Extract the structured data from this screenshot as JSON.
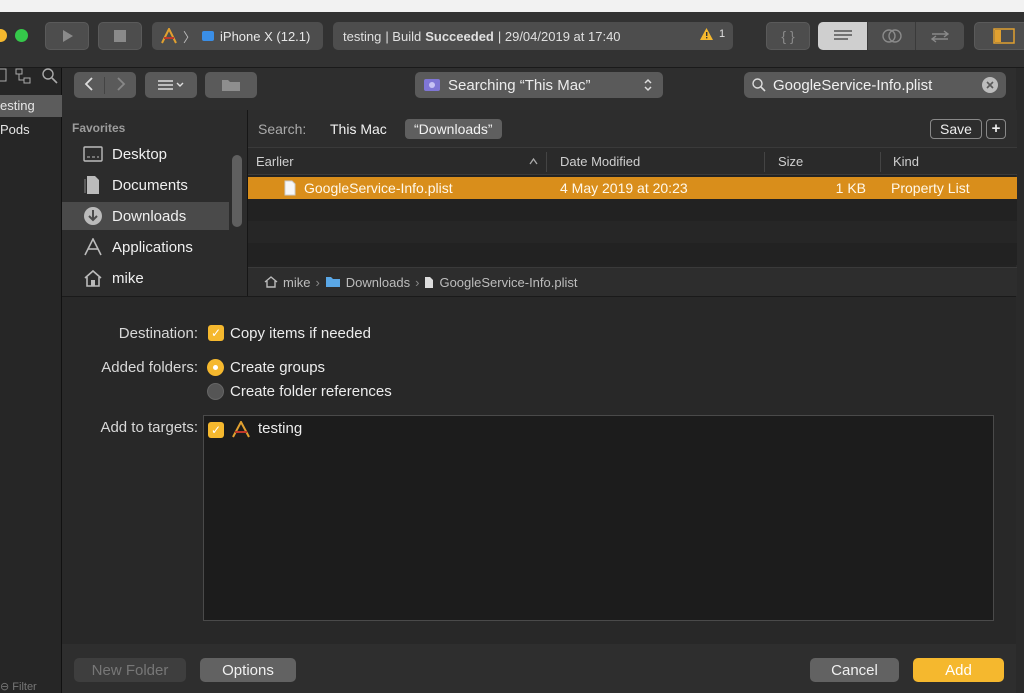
{
  "toolbar": {
    "device": "iPhone X (12.1)",
    "activity_project": "testing",
    "activity_sep": "| Build",
    "activity_status": "Succeeded",
    "activity_time": "| 29/04/2019 at 17:40",
    "warning_count": "1"
  },
  "navigator": {
    "items": [
      "esting",
      "Pods"
    ],
    "filter_placeholder": "Filter"
  },
  "sheet": {
    "location": "Searching “This Mac”",
    "search_value": "GoogleService-Info.plist",
    "sidebar": {
      "heading": "Favorites",
      "items": [
        {
          "label": "Desktop",
          "icon": "desktop-icon"
        },
        {
          "label": "Documents",
          "icon": "documents-icon"
        },
        {
          "label": "Downloads",
          "icon": "downloads-icon"
        },
        {
          "label": "Applications",
          "icon": "applications-icon"
        },
        {
          "label": "mike",
          "icon": "home-icon"
        }
      ]
    },
    "scope": {
      "label": "Search:",
      "this_mac": "This Mac",
      "downloads": "“Downloads”",
      "save": "Save",
      "add": "+"
    },
    "columns": {
      "name": "Earlier",
      "date": "Date Modified",
      "size": "Size",
      "kind": "Kind"
    },
    "rows": [
      {
        "name": "GoogleService-Info.plist",
        "date": "4 May 2019 at 20:23",
        "size": "1 KB",
        "kind": "Property List"
      }
    ],
    "path": [
      "mike",
      "Downloads",
      "GoogleService-Info.plist"
    ],
    "options": {
      "destination_label": "Destination:",
      "copy_items": "Copy items if needed",
      "added_folders_label": "Added folders:",
      "create_groups": "Create groups",
      "create_refs": "Create folder references",
      "targets_label": "Add to targets:",
      "target_name": "testing"
    },
    "buttons": {
      "new_folder": "New Folder",
      "options": "Options",
      "cancel": "Cancel",
      "add": "Add"
    }
  },
  "colors": {
    "accent": "#f5b82e",
    "selection": "#d98e1b"
  }
}
